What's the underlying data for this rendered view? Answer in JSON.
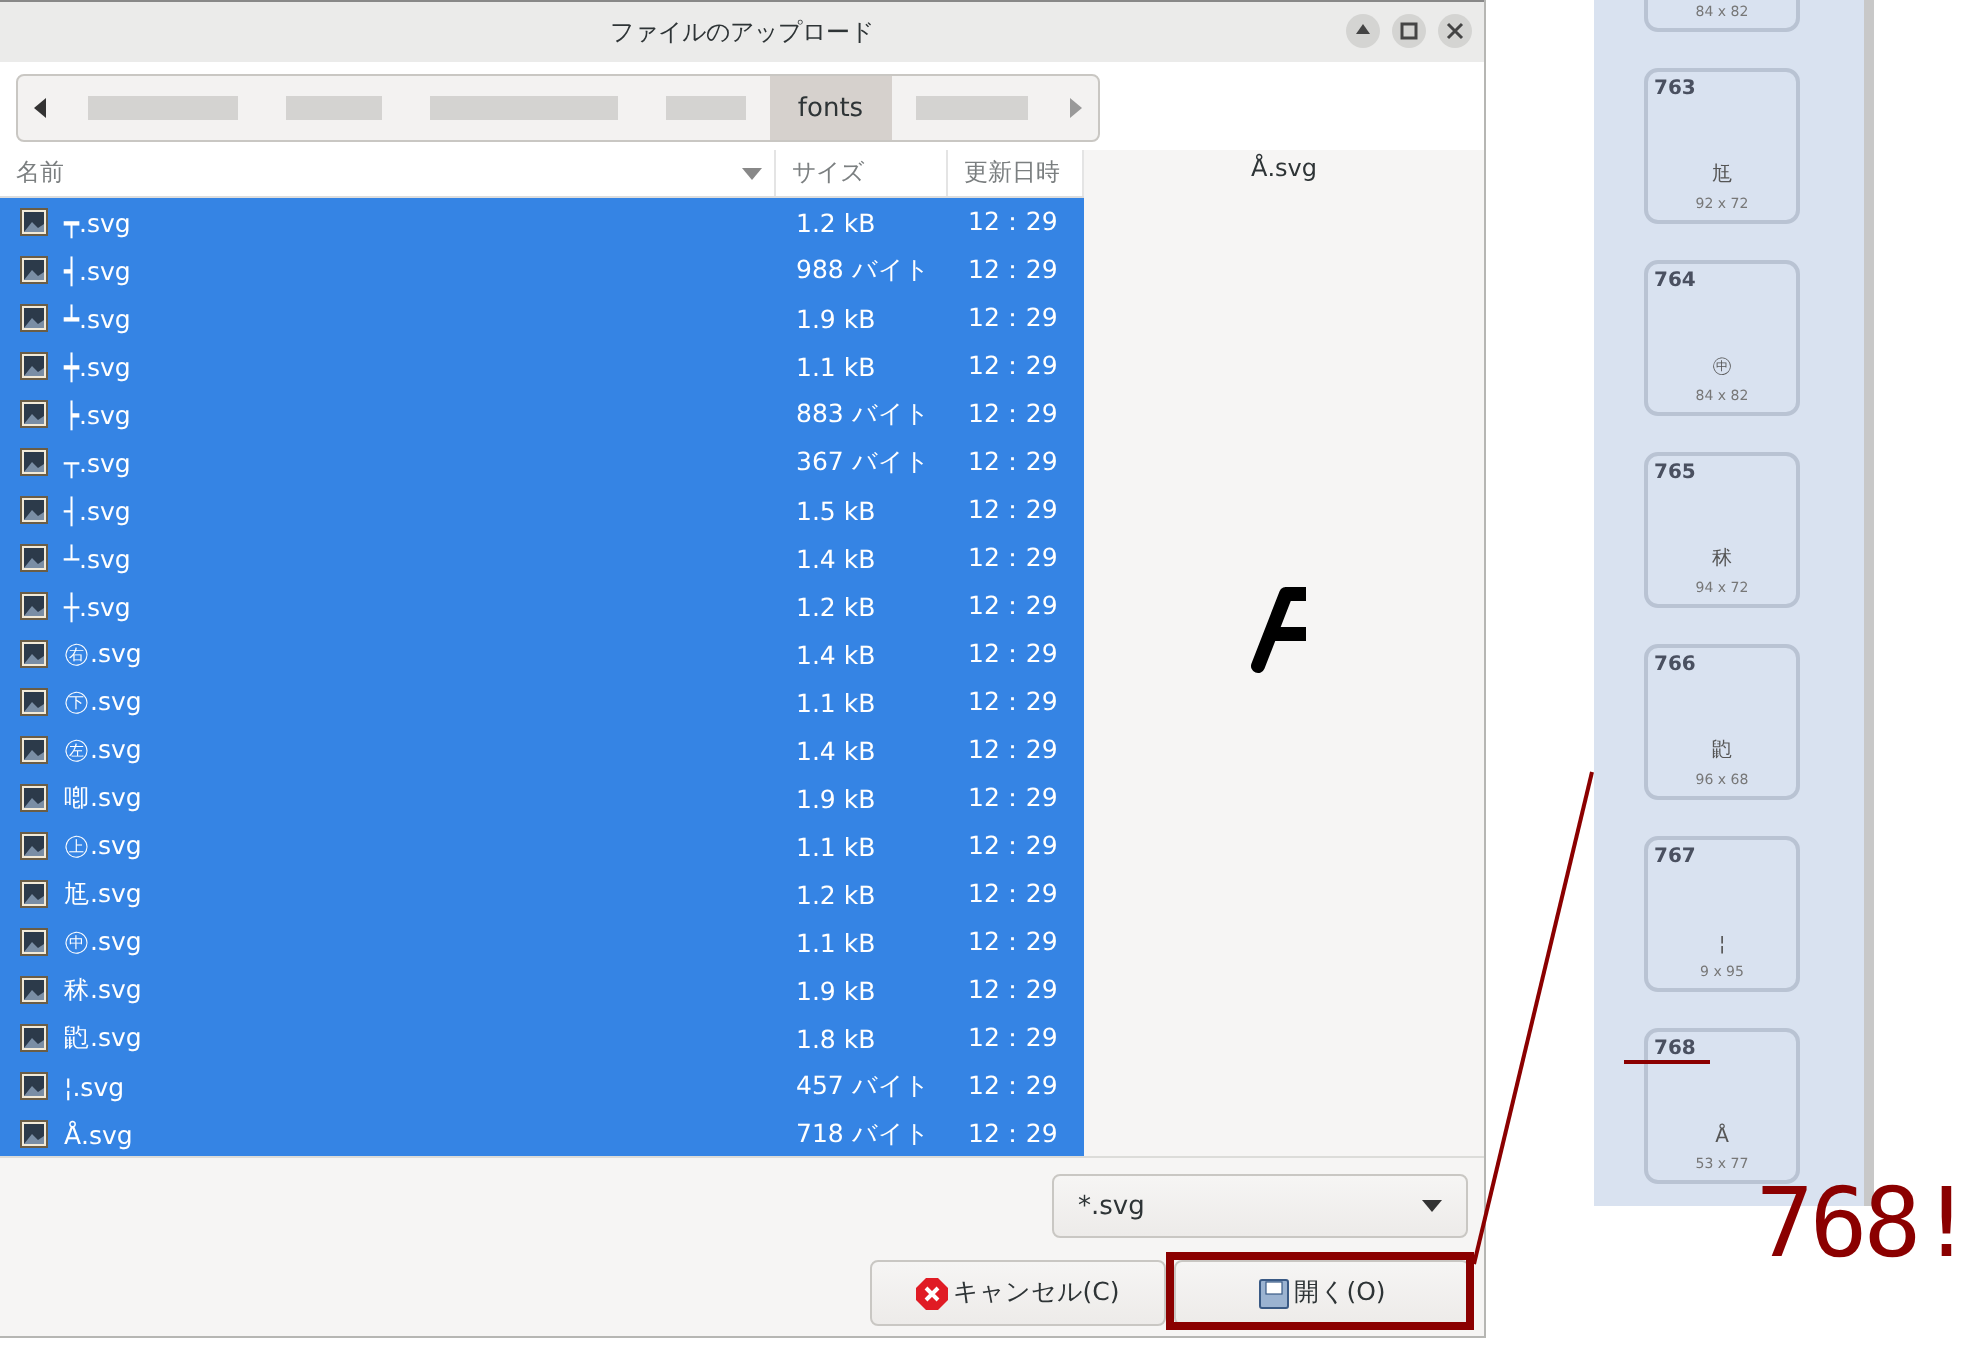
{
  "window": {
    "title": "ファイルのアップロード"
  },
  "path_bar": {
    "segments": [
      {
        "label": "fonts",
        "selected": true
      }
    ]
  },
  "file_list": {
    "columns": [
      "名前",
      "サイズ",
      "更新日時"
    ],
    "rows": [
      {
        "name": "┯.svg",
        "size": "1.2 kB",
        "modified": "12：29",
        "selected": true
      },
      {
        "name": "┥.svg",
        "size": "988 バイト",
        "modified": "12：29",
        "selected": true
      },
      {
        "name": "┷.svg",
        "size": "1.9 kB",
        "modified": "12：29",
        "selected": true
      },
      {
        "name": "┿.svg",
        "size": "1.1 kB",
        "modified": "12：29",
        "selected": true
      },
      {
        "name": "┝.svg",
        "size": "883 バイト",
        "modified": "12：29",
        "selected": true
      },
      {
        "name": "┬.svg",
        "size": "367 バイト",
        "modified": "12：29",
        "selected": true
      },
      {
        "name": "┤.svg",
        "size": "1.5 kB",
        "modified": "12：29",
        "selected": true
      },
      {
        "name": "┴.svg",
        "size": "1.4 kB",
        "modified": "12：29",
        "selected": true
      },
      {
        "name": "┼.svg",
        "size": "1.2 kB",
        "modified": "12：29",
        "selected": true
      },
      {
        "name": "㊨.svg",
        "size": "1.4 kB",
        "modified": "12：29",
        "selected": true
      },
      {
        "name": "㊦.svg",
        "size": "1.1 kB",
        "modified": "12：29",
        "selected": true
      },
      {
        "name": "㊧.svg",
        "size": "1.4 kB",
        "modified": "12：29",
        "selected": true
      },
      {
        "name": "喞.svg",
        "size": "1.9 kB",
        "modified": "12：29",
        "selected": true
      },
      {
        "name": "㊤.svg",
        "size": "1.1 kB",
        "modified": "12：29",
        "selected": true
      },
      {
        "name": "尪.svg",
        "size": "1.2 kB",
        "modified": "12：29",
        "selected": true
      },
      {
        "name": "㊥.svg",
        "size": "1.1 kB",
        "modified": "12：29",
        "selected": true
      },
      {
        "name": "秫.svg",
        "size": "1.9 kB",
        "modified": "12：29",
        "selected": true
      },
      {
        "name": "䶂.svg",
        "size": "1.8 kB",
        "modified": "12：29",
        "selected": true
      },
      {
        "name": "¦.svg",
        "size": "457 バイト",
        "modified": "12：29",
        "selected": true
      },
      {
        "name": "Å.svg",
        "size": "718 バイト",
        "modified": "12：29",
        "selected": true
      }
    ]
  },
  "preview": {
    "title": "Å.svg"
  },
  "filter": {
    "value": "*.svg"
  },
  "buttons": [
    {
      "label": "キャンセル(C)",
      "kind": "cancel"
    },
    {
      "label": "開く(O)",
      "kind": "open"
    }
  ],
  "glyph_strip": {
    "cards": [
      {
        "dimensions": "84 x 82"
      },
      {
        "number": "763",
        "glyph": "尪",
        "dimensions": "92 x 72"
      },
      {
        "number": "764",
        "glyph": "㊥",
        "dimensions": "84 x 82"
      },
      {
        "number": "765",
        "glyph": "秫",
        "dimensions": "94 x 72"
      },
      {
        "number": "766",
        "glyph": "䶂",
        "dimensions": "96 x 68"
      },
      {
        "number": "767",
        "glyph": "¦",
        "dimensions": "9 x 95"
      },
      {
        "number": "768",
        "glyph": "Å",
        "dimensions": "53 x 77"
      }
    ]
  },
  "callout": {
    "text": "768!"
  }
}
